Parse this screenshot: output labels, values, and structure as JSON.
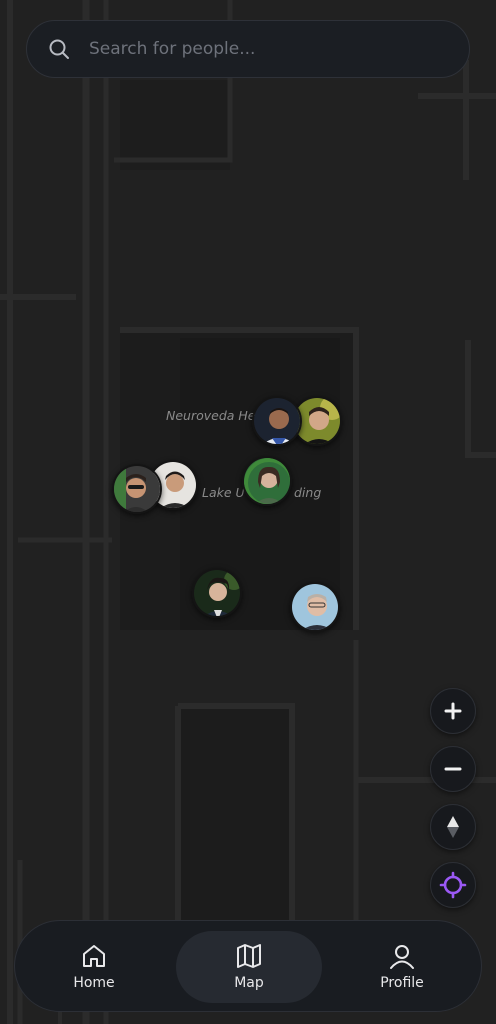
{
  "search": {
    "placeholder": "Search for people...",
    "icon": "search-icon"
  },
  "map": {
    "labels": {
      "building_1": "Neuroveda He",
      "building_2": "Lake U",
      "building_2_suffix": "ding"
    }
  },
  "avatars": [
    {
      "name": "avatar-person-1",
      "icon": "avatar"
    },
    {
      "name": "avatar-person-2",
      "icon": "avatar"
    },
    {
      "name": "avatar-person-3",
      "icon": "avatar"
    },
    {
      "name": "avatar-person-4",
      "icon": "avatar"
    },
    {
      "name": "avatar-person-5",
      "icon": "avatar"
    },
    {
      "name": "avatar-person-6",
      "icon": "avatar"
    },
    {
      "name": "avatar-person-7",
      "icon": "avatar"
    }
  ],
  "controls": {
    "zoom_in": "plus-icon",
    "zoom_out": "minus-icon",
    "compass": "compass-icon",
    "locate": "locate-icon",
    "accent": "#9b59f5"
  },
  "bottom_nav": {
    "items": [
      {
        "label": "Home",
        "icon": "home-icon",
        "active": false
      },
      {
        "label": "Map",
        "icon": "map-icon",
        "active": true
      },
      {
        "label": "Profile",
        "icon": "profile-icon",
        "active": false
      }
    ]
  }
}
